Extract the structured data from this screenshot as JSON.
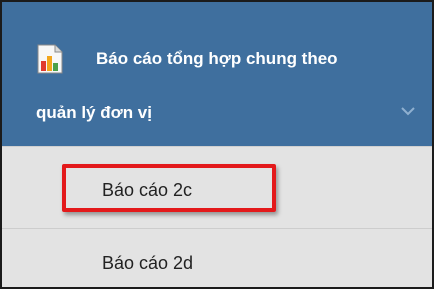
{
  "menu": {
    "header": {
      "icon": "report-chart-icon",
      "title_line1": "Báo cáo tổng hợp chung theo",
      "title_line2": "quản lý đơn vị",
      "expand_icon": "chevron-down-icon",
      "background_color": "#3f6f9e"
    },
    "items": [
      {
        "label": "Báo cáo 2c",
        "highlighted": true
      },
      {
        "label": "Báo cáo 2d",
        "highlighted": false
      }
    ],
    "item_background_color": "#e3e3e3"
  },
  "annotation": {
    "highlight_color": "#e3191b"
  }
}
